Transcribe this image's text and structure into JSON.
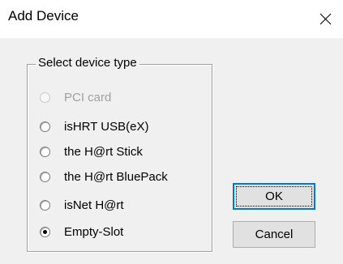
{
  "window": {
    "title": "Add Device",
    "close_icon": "close-icon"
  },
  "group": {
    "label": "Select device type",
    "options": [
      {
        "label": "PCI card",
        "checked": false,
        "enabled": false
      },
      {
        "label": "isHRT USB(eX)",
        "checked": false,
        "enabled": true
      },
      {
        "label": "the H@rt Stick",
        "checked": false,
        "enabled": true
      },
      {
        "label": "the H@rt BluePack",
        "checked": false,
        "enabled": true
      },
      {
        "label": "isNet H@rt",
        "checked": false,
        "enabled": true
      },
      {
        "label": "Empty-Slot",
        "checked": true,
        "enabled": true
      }
    ]
  },
  "buttons": {
    "ok_label": "OK",
    "cancel_label": "Cancel"
  },
  "colors": {
    "focus_border": "#0078d7",
    "disabled_text": "#a0a0a0"
  }
}
